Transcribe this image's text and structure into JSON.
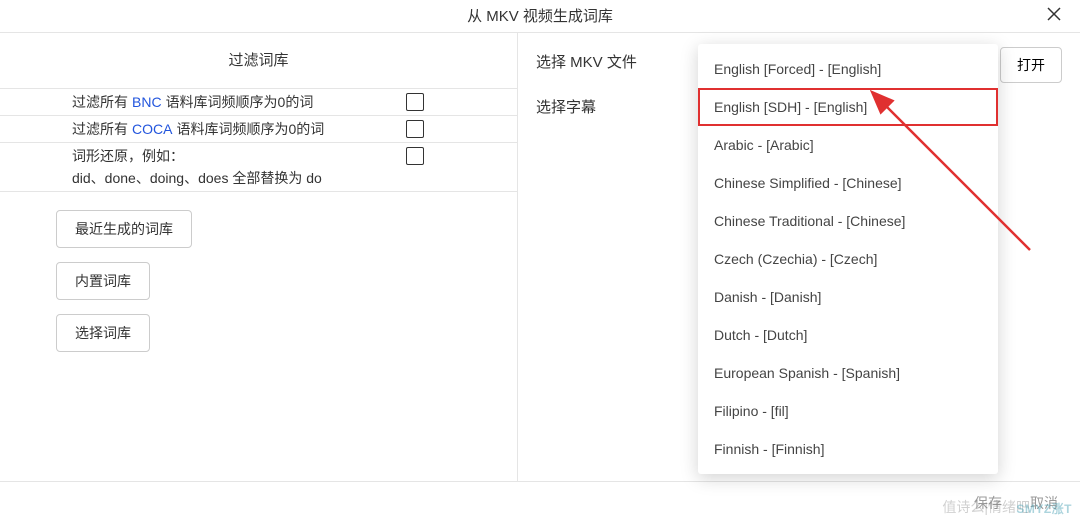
{
  "window": {
    "title": "从 MKV 视频生成词库"
  },
  "left": {
    "section_title": "过滤词库",
    "filter1": {
      "prefix": "过滤所有",
      "highlight": "BNC",
      "suffix": "语料库词频顺序为0的词"
    },
    "filter2": {
      "prefix": "过滤所有",
      "highlight": "COCA",
      "suffix": "语料库词频顺序为0的词"
    },
    "filter3": {
      "line1": "词形还原，例如：",
      "line2": "did、done、doing、does 全部替换为 do"
    },
    "buttons": {
      "recent": "最近生成的词库",
      "builtin": "内置词库",
      "choose": "选择词库"
    }
  },
  "right": {
    "select_file": "选择 MKV 文件",
    "select_subtitle": "选择字幕",
    "open": "打开"
  },
  "dropdown": {
    "items": [
      "English [Forced] - [English]",
      "English [SDH] - [English]",
      "Arabic - [Arabic]",
      "Chinese Simplified - [Chinese]",
      "Chinese Traditional - [Chinese]",
      "Czech (Czechia) - [Czech]",
      "Danish - [Danish]",
      "Dutch - [Dutch]",
      "European Spanish - [Spanish]",
      "Filipino - [fil]",
      "Finnish - [Finnish]"
    ],
    "highlighted_index": 1
  },
  "footer": {
    "save": "保存",
    "cancel": "取消"
  },
  "watermark": {
    "w1": "值诗么|情绪吧",
    "w2": "SMYZ涨T"
  }
}
